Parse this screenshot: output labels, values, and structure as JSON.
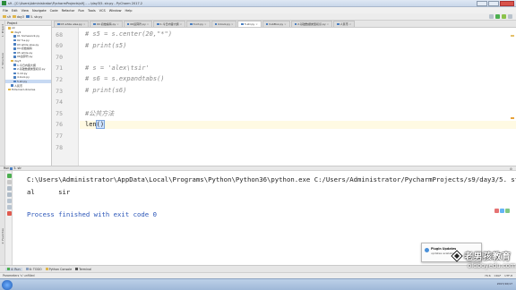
{
  "window": {
    "title": "s9 - [C:\\Users\\Administrator\\PycharmProjects\\s9] - ...\\day3\\5. str.py - PyCharm 2017.2"
  },
  "menu": [
    "File",
    "Edit",
    "View",
    "Navigate",
    "Code",
    "Refactor",
    "Run",
    "Tools",
    "VCS",
    "Window",
    "Help"
  ],
  "breadcrumb": [
    "s9",
    "day3",
    "5. str.py"
  ],
  "project": {
    "header": "Project",
    "items": [
      {
        "label": "s9",
        "type": "folder",
        "indent": 1
      },
      {
        "label": "day2",
        "type": "folder",
        "indent": 2
      },
      {
        "label": "01 homework.py",
        "type": "py",
        "indent": 3
      },
      {
        "label": "02 %s.py",
        "type": "py",
        "indent": 3
      },
      {
        "label": "03 while else.py",
        "type": "py",
        "indent": 3
      },
      {
        "label": "04 初始编码",
        "type": "py",
        "indent": 3
      },
      {
        "label": "05 while.py",
        "type": "py",
        "indent": 3
      },
      {
        "label": "06运算符.py",
        "type": "py",
        "indent": 3
      },
      {
        "label": "day3",
        "type": "folder",
        "indent": 2
      },
      {
        "label": "1.今日内容大纲",
        "type": "py",
        "indent": 3
      },
      {
        "label": "2.基础数据类型初识.py",
        "type": "py",
        "indent": 3
      },
      {
        "label": "3.int.py",
        "type": "py",
        "indent": 3
      },
      {
        "label": "4.bool.py",
        "type": "py",
        "indent": 3
      },
      {
        "label": "5.str.py",
        "type": "py",
        "indent": 3,
        "selected": true
      },
      {
        "label": "人民币",
        "type": "py",
        "indent": 2
      },
      {
        "label": "External Libraries",
        "type": "folder",
        "indent": 1
      }
    ]
  },
  "side_tabs": [
    "1: Project",
    "7: Structure",
    "2: Favorites"
  ],
  "editor_tabs": [
    {
      "label": "03 while else.py",
      "active": false
    },
    {
      "label": "04 初始编码.py",
      "active": false
    },
    {
      "label": "06运算符.py",
      "active": false
    },
    {
      "label": "1.今日内容大纲",
      "active": false
    },
    {
      "label": "3.int.py",
      "active": false
    },
    {
      "label": "4.bool.py",
      "active": false
    },
    {
      "label": "5.str.py",
      "active": true
    },
    {
      "label": "hubBox.py",
      "active": false
    },
    {
      "label": "2.基础数据类型初识.py",
      "active": false
    },
    {
      "label": "人民币",
      "active": false
    }
  ],
  "code_lines": [
    {
      "num": "68",
      "text": "# s5 = s.center(20,\"*\")",
      "kind": "comment"
    },
    {
      "num": "69",
      "text": "# print(s5)",
      "kind": "comment"
    },
    {
      "num": "70",
      "text": "",
      "kind": "plain"
    },
    {
      "num": "71",
      "text": "# s = 'alex\\tsir'",
      "kind": "comment"
    },
    {
      "num": "72",
      "text": "# s6 = s.expandtabs()",
      "kind": "comment"
    },
    {
      "num": "73",
      "text": "# print(s6)",
      "kind": "comment"
    },
    {
      "num": "74",
      "text": "",
      "kind": "plain"
    },
    {
      "num": "75",
      "text": "#公共方法",
      "kind": "comment"
    },
    {
      "num": "76",
      "text": "len()",
      "kind": "current"
    },
    {
      "num": "77",
      "text": "",
      "kind": "plain"
    },
    {
      "num": "78",
      "text": "",
      "kind": "plain"
    }
  ],
  "run": {
    "tab_label": "Run",
    "config": "5. str",
    "lines": [
      {
        "text": "C:\\Users\\Administrator\\AppData\\Local\\Programs\\Python\\Python36\\python.exe C:/Users/Administrator/PycharmProjects/s9/day3/5. str.py",
        "kind": "path"
      },
      {
        "text": "al      sir",
        "kind": "output"
      },
      {
        "text": "",
        "kind": "output"
      },
      {
        "text": "Process finished with exit code 0",
        "kind": "exit"
      }
    ]
  },
  "bottom_tools": [
    {
      "label": "4: Run",
      "active": true
    },
    {
      "label": "6: TODO",
      "active": false
    },
    {
      "label": "Python Console",
      "active": false
    },
    {
      "label": "Terminal",
      "active": false
    }
  ],
  "status": {
    "left": "Parameters 's' unfilled",
    "right": [
      "76:6",
      "CRLF",
      "UTF-8"
    ]
  },
  "notification": {
    "title": "Plugin Updates",
    "text": "updates available"
  },
  "watermark": {
    "name": "老男孩教育",
    "url": "oldboyedu.com"
  },
  "taskbar": {
    "clock": "2017/10/17"
  }
}
